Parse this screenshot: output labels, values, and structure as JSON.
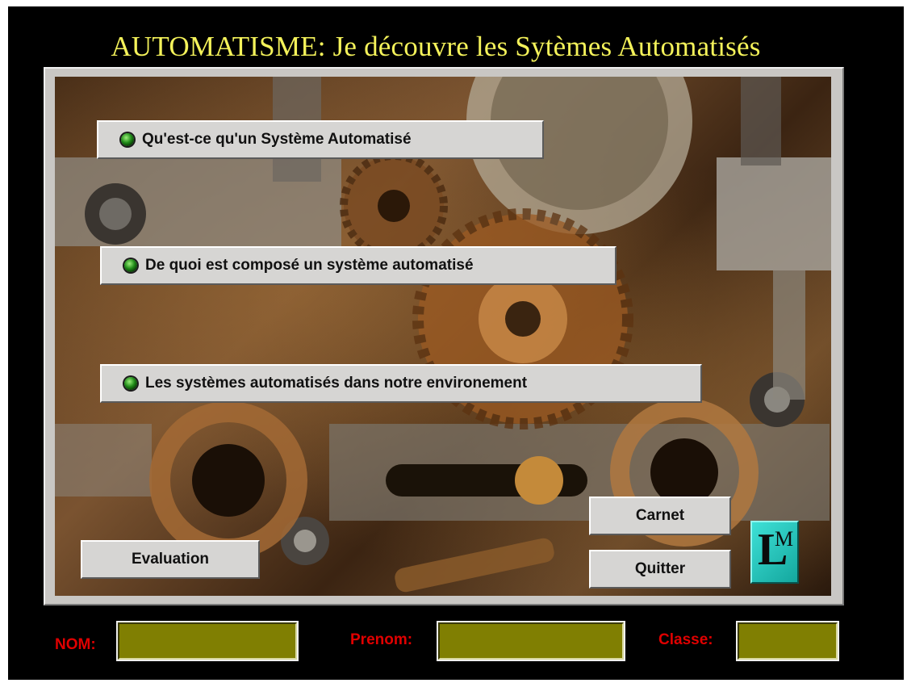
{
  "title": "AUTOMATISME: Je découvre les Sytèmes Automatisés",
  "menu": [
    {
      "label": "Qu'est-ce qu'un Système Automatisé"
    },
    {
      "label": "De quoi est composé un système automatisé"
    },
    {
      "label": "Les systèmes automatisés dans notre environement"
    }
  ],
  "buttons": {
    "evaluation": "Evaluation",
    "carnet": "Carnet",
    "quitter": "Quitter"
  },
  "logo": {
    "letter_large": "L",
    "letter_small": "M"
  },
  "fields": {
    "nom": {
      "label": "NOM:",
      "value": ""
    },
    "prenom": {
      "label": "Prenom:",
      "value": ""
    },
    "classe": {
      "label": "Classe:",
      "value": ""
    }
  },
  "colors": {
    "title": "#f4f25a",
    "field_label": "#e00000",
    "field_bg": "#807f02",
    "led": "#1f8a18",
    "logo": "#2ac8bf"
  }
}
